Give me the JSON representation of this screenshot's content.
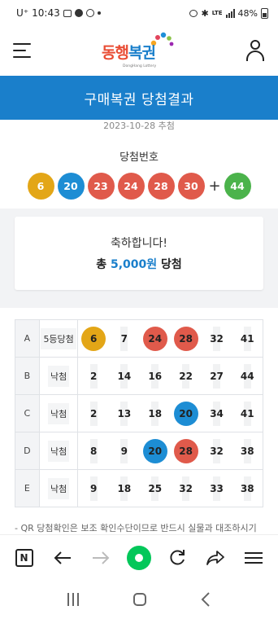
{
  "status_bar": {
    "carrier": "U⁺",
    "time": "10:43",
    "network": "LTE",
    "battery": "48%"
  },
  "header": {
    "logo_text": "동행복권",
    "logo_subtext": "DongHang Lottery"
  },
  "page_title": "구매복권 당첨결과",
  "draw_date": "2023-10-28 추첨",
  "winning_label": "당첨번호",
  "winning_numbers": [
    {
      "n": "6",
      "color": "#e3a617"
    },
    {
      "n": "20",
      "color": "#1d8dd4"
    },
    {
      "n": "23",
      "color": "#e05a4b"
    },
    {
      "n": "24",
      "color": "#e05a4b"
    },
    {
      "n": "28",
      "color": "#e05a4b"
    },
    {
      "n": "30",
      "color": "#e05a4b"
    }
  ],
  "plus_sign": "+",
  "bonus_number": {
    "n": "44",
    "color": "#4bb34b"
  },
  "congrats": {
    "line1": "축하합니다!",
    "prefix": "총",
    "amount": "5,000원",
    "suffix": "당첨"
  },
  "results": [
    {
      "label": "A",
      "result": "5등당첨",
      "numbers": [
        {
          "n": "6",
          "hit": "#e3a617"
        },
        {
          "n": "7"
        },
        {
          "n": "24",
          "hit": "#e05a4b"
        },
        {
          "n": "28",
          "hit": "#e05a4b"
        },
        {
          "n": "32"
        },
        {
          "n": "41"
        }
      ]
    },
    {
      "label": "B",
      "result": "낙첨",
      "numbers": [
        {
          "n": "2"
        },
        {
          "n": "14"
        },
        {
          "n": "16"
        },
        {
          "n": "22"
        },
        {
          "n": "27"
        },
        {
          "n": "44"
        }
      ]
    },
    {
      "label": "C",
      "result": "낙첨",
      "numbers": [
        {
          "n": "2"
        },
        {
          "n": "13"
        },
        {
          "n": "18"
        },
        {
          "n": "20",
          "hit": "#1d8dd4"
        },
        {
          "n": "34"
        },
        {
          "n": "41"
        }
      ]
    },
    {
      "label": "D",
      "result": "낙첨",
      "numbers": [
        {
          "n": "8"
        },
        {
          "n": "9"
        },
        {
          "n": "20",
          "hit": "#1d8dd4"
        },
        {
          "n": "28",
          "hit": "#e05a4b"
        },
        {
          "n": "32"
        },
        {
          "n": "38"
        }
      ]
    },
    {
      "label": "E",
      "result": "낙첨",
      "numbers": [
        {
          "n": "9"
        },
        {
          "n": "18"
        },
        {
          "n": "25"
        },
        {
          "n": "32"
        },
        {
          "n": "33"
        },
        {
          "n": "38"
        }
      ]
    }
  ],
  "notice": "- QR 당첨확인은 보조 확인수단이므로 반드시 실물과 대조하시기",
  "browser_bar": {
    "n_button": "N"
  }
}
